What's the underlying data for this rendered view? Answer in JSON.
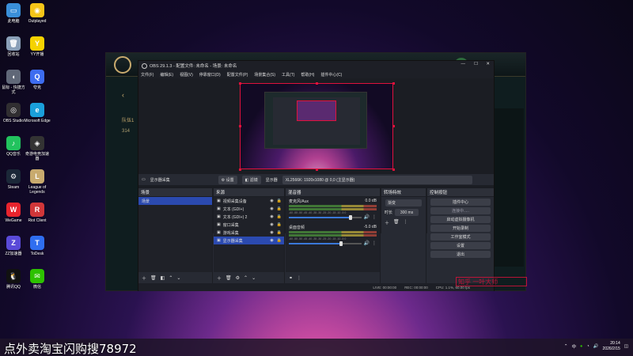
{
  "desktop_icons": [
    {
      "label": "此电脑",
      "color": "#3a8fd9",
      "glyph": "▭"
    },
    {
      "label": "Outplayed",
      "color": "#f5c518",
      "glyph": "◉"
    },
    {
      "label": "回收站",
      "color": "#8aa0b8",
      "glyph": "🗑"
    },
    {
      "label": "YY开播",
      "color": "#f5d200",
      "glyph": "Y"
    },
    {
      "label": "鼠标 - 快捷方式",
      "color": "#606878",
      "glyph": "◖"
    },
    {
      "label": "夸克",
      "color": "#3d6cf0",
      "glyph": "Q"
    },
    {
      "label": "OBS Studio",
      "color": "#302e31",
      "glyph": "◎"
    },
    {
      "label": "Microsoft Edge",
      "color": "#1a9fda",
      "glyph": "e"
    },
    {
      "label": "QQ音乐",
      "color": "#22c35e",
      "glyph": "♪"
    },
    {
      "label": "奇游电竞加速器",
      "color": "#333",
      "glyph": "◈"
    },
    {
      "label": "Steam",
      "color": "#1b2838",
      "glyph": "⚙"
    },
    {
      "label": "League of Legends",
      "color": "#c8aa6e",
      "glyph": "L"
    },
    {
      "label": "WeGame",
      "color": "#e8232d",
      "glyph": "W"
    },
    {
      "label": "Riot Client",
      "color": "#d13639",
      "glyph": "R"
    },
    {
      "label": "ZZ加速器",
      "color": "#5a4ad8",
      "glyph": "Z"
    },
    {
      "label": "ToDesk",
      "color": "#2f6ef0",
      "glyph": "T"
    },
    {
      "label": "腾讯QQ",
      "color": "#111",
      "glyph": "🐧"
    },
    {
      "label": "微信",
      "color": "#2dc100",
      "glyph": "✉"
    }
  ],
  "obs": {
    "title": "OBS 29.1.3 - 配置文件: 未命名 - 场景: 未命名",
    "menu": [
      "文件(F)",
      "编辑(E)",
      "视图(V)",
      "停靠窗口(D)",
      "配置文件(P)",
      "场景集合(S)",
      "工具(T)",
      "帮助(H)",
      "插件中心(C)"
    ],
    "source_bar": {
      "source_name": "显示器采集",
      "settings": "设置",
      "filters": "滤镜",
      "display_label": "显示器",
      "display_value": "XL2566K: 1920x1080 @ 0,0 (主显示器)"
    },
    "scenes": {
      "title": "场景",
      "items": [
        "场景"
      ]
    },
    "sources": {
      "title": "来源",
      "items": [
        "视频采集设备",
        "文本 (GDI+)",
        "文本 (GDI+) 2",
        "窗口采集",
        "游戏采集",
        "显示器采集"
      ]
    },
    "mixer": {
      "title": "混音器",
      "channels": [
        {
          "name": "麦克风/Aux",
          "db": "0.0 dB",
          "level": 0.85
        },
        {
          "name": "桌面音频",
          "db": "-5.0 dB",
          "level": 0.72
        }
      ],
      "scale": "-60 -55 -50 -45 -40 -35 -30 -25 -20 -15 -10 -5 0"
    },
    "transitions": {
      "title": "转场特效",
      "type": "渐变",
      "duration_label": "时长",
      "duration": "300 ms"
    },
    "controls": {
      "title": "控制按钮",
      "buttons": [
        "插件中心",
        "连接中.....",
        "启动虚拟摄像机",
        "开始录制",
        "工作室模式",
        "设置",
        "退出"
      ]
    },
    "status": {
      "live": "LIVE: 00:00:00",
      "rec": "REC: 00:00:00",
      "cpu": "CPU: 1.1%, 60.00 fps"
    }
  },
  "game": {
    "left_labels": [
      "队伍1",
      "314"
    ]
  },
  "overlay_text": "点外卖淘宝闪购搜78972",
  "watermark_text": "知乎 一叶大师",
  "tray": {
    "ime": "中",
    "time": "20:14",
    "date": "2026/2/15"
  }
}
